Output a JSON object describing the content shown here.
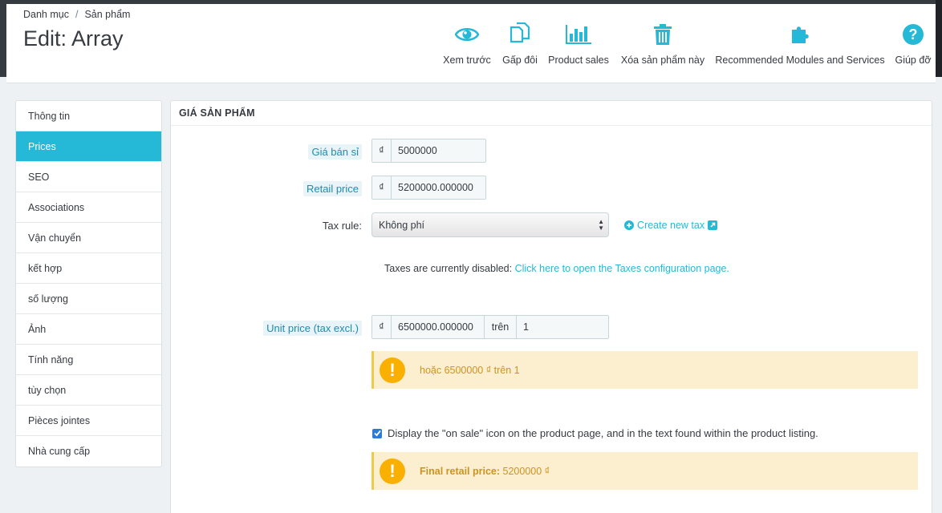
{
  "breadcrumb": {
    "parent": "Danh mục",
    "separator": "/",
    "current": "Sản phẩm"
  },
  "page_title": "Edit: Array",
  "toolbar": [
    {
      "label": "Xem trước",
      "icon": "eye-icon"
    },
    {
      "label": "Gấp đôi",
      "icon": "duplicate-icon"
    },
    {
      "label": "Product sales",
      "icon": "bar-chart-icon"
    },
    {
      "label": "Xóa sản phẩm này",
      "icon": "trash-icon"
    },
    {
      "label": "Recommended Modules and Services",
      "icon": "puzzle-icon"
    },
    {
      "label": "Giúp đỡ",
      "icon": "help-icon"
    }
  ],
  "sidebar": {
    "items": [
      {
        "label": "Thông tin",
        "active": false
      },
      {
        "label": "Prices",
        "active": true
      },
      {
        "label": "SEO",
        "active": false
      },
      {
        "label": "Associations",
        "active": false
      },
      {
        "label": "Vận chuyển",
        "active": false
      },
      {
        "label": "kết hợp",
        "active": false
      },
      {
        "label": "số lượng",
        "active": false
      },
      {
        "label": "Ảnh",
        "active": false
      },
      {
        "label": "Tính năng",
        "active": false
      },
      {
        "label": "tùy chọn",
        "active": false
      },
      {
        "label": "Pièces jointes",
        "active": false
      },
      {
        "label": "Nhà cung cấp",
        "active": false
      }
    ]
  },
  "panel": {
    "title": "Giá sản phẩm",
    "wholesale": {
      "label": "Giá bán sỉ",
      "currency": "₫",
      "value": "5000000"
    },
    "retail": {
      "label": "Retail price",
      "currency": "₫",
      "value": "5200000.000000"
    },
    "tax_rule": {
      "label": "Tax rule:",
      "selected": "Không phí",
      "create_link": "Create new tax"
    },
    "taxes_note": {
      "text": "Taxes are currently disabled:",
      "link": "Click here to open the Taxes configuration page."
    },
    "unit_price": {
      "label": "Unit price (tax excl.)",
      "currency": "₫",
      "value": "6500000.000000",
      "per_label": "trên",
      "per_value": "1"
    },
    "unit_alert": "hoặc 6500000 ₫ trên 1",
    "on_sale": {
      "checked": true,
      "label": "Display the \"on sale\" icon on the product page, and in the text found within the product listing."
    },
    "final_alert": {
      "label": "Final retail price:",
      "value": "5200000 ₫"
    }
  },
  "colors": {
    "accent": "#25b9d7",
    "warning_bg": "#fcefcf",
    "warning_icon": "#fab000"
  }
}
